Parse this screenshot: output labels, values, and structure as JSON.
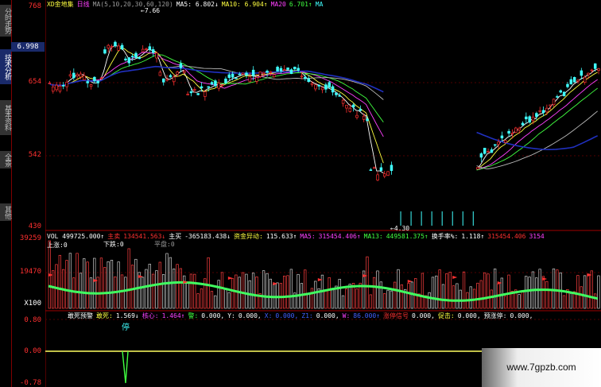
{
  "sidebar": {
    "tabs": [
      {
        "label": "分时走势",
        "state": "inactive"
      },
      {
        "label": "技术分析",
        "state": "active"
      },
      {
        "label": "基本资料",
        "state": "inactive"
      },
      {
        "label": "全景",
        "state": "inactive"
      },
      {
        "label": "其他",
        "state": "inactive"
      }
    ]
  },
  "axis": {
    "price_ticks": [
      "768",
      "654",
      "542",
      "430"
    ],
    "current_price": "6.998",
    "volume_ticks": [
      "39259",
      "19470"
    ],
    "volume_unit": "X100",
    "indicator_ticks": [
      "0.80",
      "0.00",
      "-0.78"
    ]
  },
  "price_panel": {
    "header": [
      {
        "text": "XD金地集",
        "color": "yellow"
      },
      {
        "text": "日线",
        "color": "pink"
      },
      {
        "text": "MA(5,10,20,30,60,120)",
        "color": "gray"
      },
      {
        "text": "MA5: 6.802↓",
        "color": "white"
      },
      {
        "text": "MA10: 6.904↑",
        "color": "yellow"
      },
      {
        "text": "MA20",
        "color": "pink"
      },
      {
        "text": "6.701↑",
        "color": "green"
      },
      {
        "text": "MA",
        "color": "cyan"
      }
    ],
    "high_marker": "7.66",
    "low_marker": "4.30"
  },
  "volume_panel": {
    "header": [
      {
        "text": "VOL 499725.000↑",
        "color": "white"
      },
      {
        "text": "主卖",
        "color": "red"
      },
      {
        "text": "134541.563↓",
        "color": "red"
      },
      {
        "text": "主买",
        "color": "white"
      },
      {
        "text": "-365183.438↓",
        "color": "white"
      },
      {
        "text": "资金异动:",
        "color": "yellow"
      },
      {
        "text": "115.633↑",
        "color": "white"
      },
      {
        "text": "MA5:",
        "color": "pink"
      },
      {
        "text": "315454.406↑",
        "color": "pink"
      },
      {
        "text": "MA13:",
        "color": "green"
      },
      {
        "text": "449581.375↑",
        "color": "green"
      },
      {
        "text": "换手率%:",
        "color": "white"
      },
      {
        "text": "1.118↑",
        "color": "white"
      },
      {
        "text": "315454.406",
        "color": "red"
      },
      {
        "text": "3154",
        "color": "pink"
      }
    ],
    "sub_labels": {
      "up": "上涨:0",
      "down": "下跌:0",
      "flat": "平盘:0"
    }
  },
  "indicator_panel": {
    "header": [
      {
        "text": "敢死预警",
        "color": "white"
      },
      {
        "text": "敢死:",
        "color": "yellow"
      },
      {
        "text": "1.569↓",
        "color": "white"
      },
      {
        "text": "核心:",
        "color": "pink"
      },
      {
        "text": "1.464↑",
        "color": "pink"
      },
      {
        "text": "警:",
        "color": "green"
      },
      {
        "text": "0.000,",
        "color": "white"
      },
      {
        "text": "Y:",
        "color": "white"
      },
      {
        "text": "0.000,",
        "color": "white"
      },
      {
        "text": "X:",
        "color": "blue"
      },
      {
        "text": "0.000,",
        "color": "blue"
      },
      {
        "text": "Z1:",
        "color": "blue"
      },
      {
        "text": "0.000,",
        "color": "white"
      },
      {
        "text": "W:",
        "color": "pink"
      },
      {
        "text": "86.000↑",
        "color": "blue"
      },
      {
        "text": "涨停信号",
        "color": "red"
      },
      {
        "text": "0.000,",
        "color": "white"
      },
      {
        "text": "促击:",
        "color": "yellow"
      },
      {
        "text": "0.000,",
        "color": "white"
      },
      {
        "text": "预涨停:",
        "color": "white"
      },
      {
        "text": "0.000,",
        "color": "white"
      }
    ],
    "stop_label": "停"
  },
  "watermark": "www.7gpzb.com",
  "colors": {
    "up": "#ff3030",
    "down": "#40ff80",
    "ma120": "#2030c0",
    "ma60": "#ffffff",
    "ma5": "#ffffff",
    "ma10": "#ffff40",
    "ma20": "#ff40ff",
    "ma30": "#40ff40"
  }
}
